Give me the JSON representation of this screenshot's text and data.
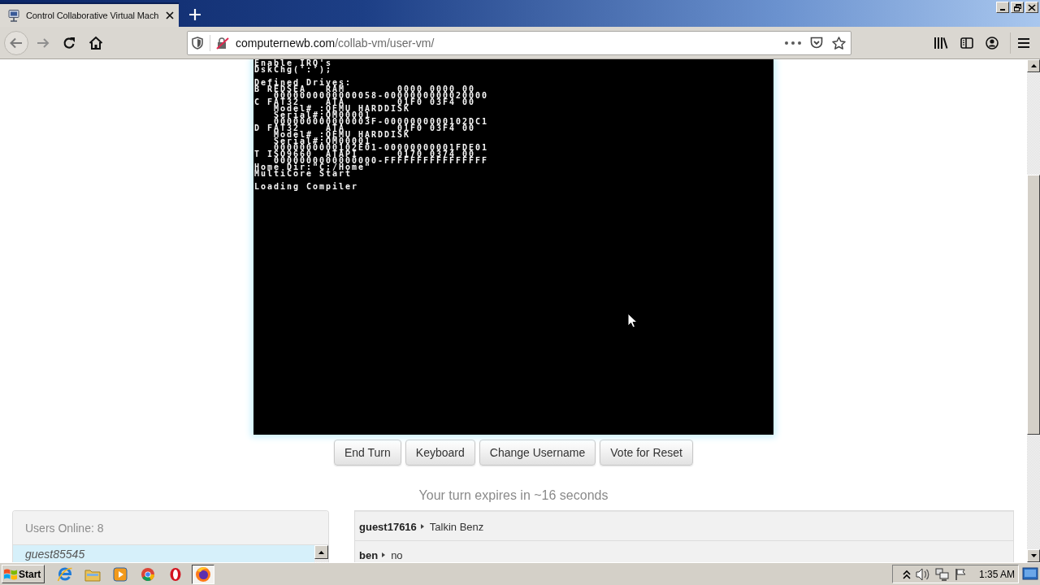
{
  "browser": {
    "tabs": [
      {
        "title": "Control Collaborative Virtual Mach",
        "selected": true
      }
    ],
    "url": {
      "host": "computernewb.com",
      "path": "/collab-vm/user-vm/"
    }
  },
  "vm_screen": {
    "blocks": [
      [
        "Enable IRQ's",
        "DskChg(':');"
      ],
      [
        "Defined Drives:",
        "B REDSEA   RAM        0000 0000 00",
        "   0000000000000058-0000000000020000",
        "C FAT32    ATA        01F0 03F4 00",
        "   Model# :QEMU HARDDISK",
        "   Serial#:QM00001",
        "   000000000000003F-0000000000102DC1",
        "D FAT32    ATA        01F0 03F4 00",
        "   Model# :QEMU HARDDISK",
        "   Serial#:QM00001",
        "   0000000000102E01-00000000001FDE01",
        "T ISO9660  ATAPI      0170 0374 00",
        "   0000000000000000-FFFFFFFFFFFFFFFF",
        "Home Dir:\"C:/Home\"",
        "MultiCore Start"
      ],
      [
        "Loading Compiler"
      ]
    ]
  },
  "buttons": [
    "End Turn",
    "Keyboard",
    "Change Username",
    "Vote for Reset"
  ],
  "turn_status": "Your turn expires in ~16 seconds",
  "users_panel": {
    "title": "Users Online: 8",
    "users": [
      {
        "name": "guest85545",
        "highlighted": true,
        "is_you": true
      }
    ]
  },
  "chat": {
    "messages": [
      {
        "user": "guest17616",
        "text": "Talkin Benz"
      },
      {
        "user": "ben",
        "text": "no"
      }
    ]
  },
  "taskbar": {
    "start_label": "Start",
    "apps": [
      {
        "kind": "ie",
        "active": false
      },
      {
        "kind": "explorer",
        "active": false
      },
      {
        "kind": "media",
        "active": false
      },
      {
        "kind": "chrome",
        "active": false
      },
      {
        "kind": "opera",
        "active": false
      },
      {
        "kind": "firefox",
        "active": true
      }
    ],
    "clock": "1:35 AM"
  }
}
